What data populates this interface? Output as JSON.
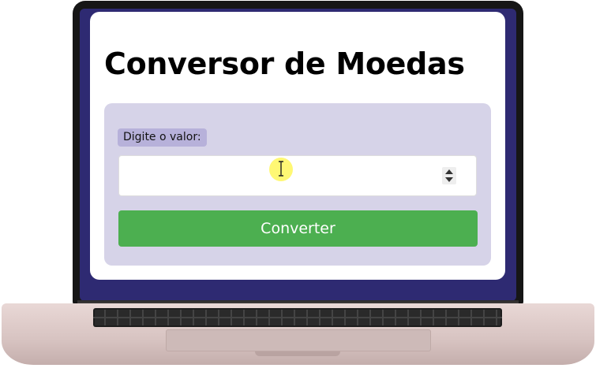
{
  "app": {
    "title": "Conversor de Moedas"
  },
  "form": {
    "value_label": "Digite o valor:",
    "value_input": {
      "value": "",
      "placeholder": ""
    },
    "convert_button_label": "Converter"
  },
  "icons": {
    "spinner": "number-spinner-icon",
    "cursor": "text-cursor-icon"
  },
  "colors": {
    "bezel": "#2e2a72",
    "card_background": "#d6d3e8",
    "label_background": "#b7b1da",
    "button": "#4caf50",
    "button_text": "#ffffff",
    "cursor_highlight": "#fff75c"
  }
}
